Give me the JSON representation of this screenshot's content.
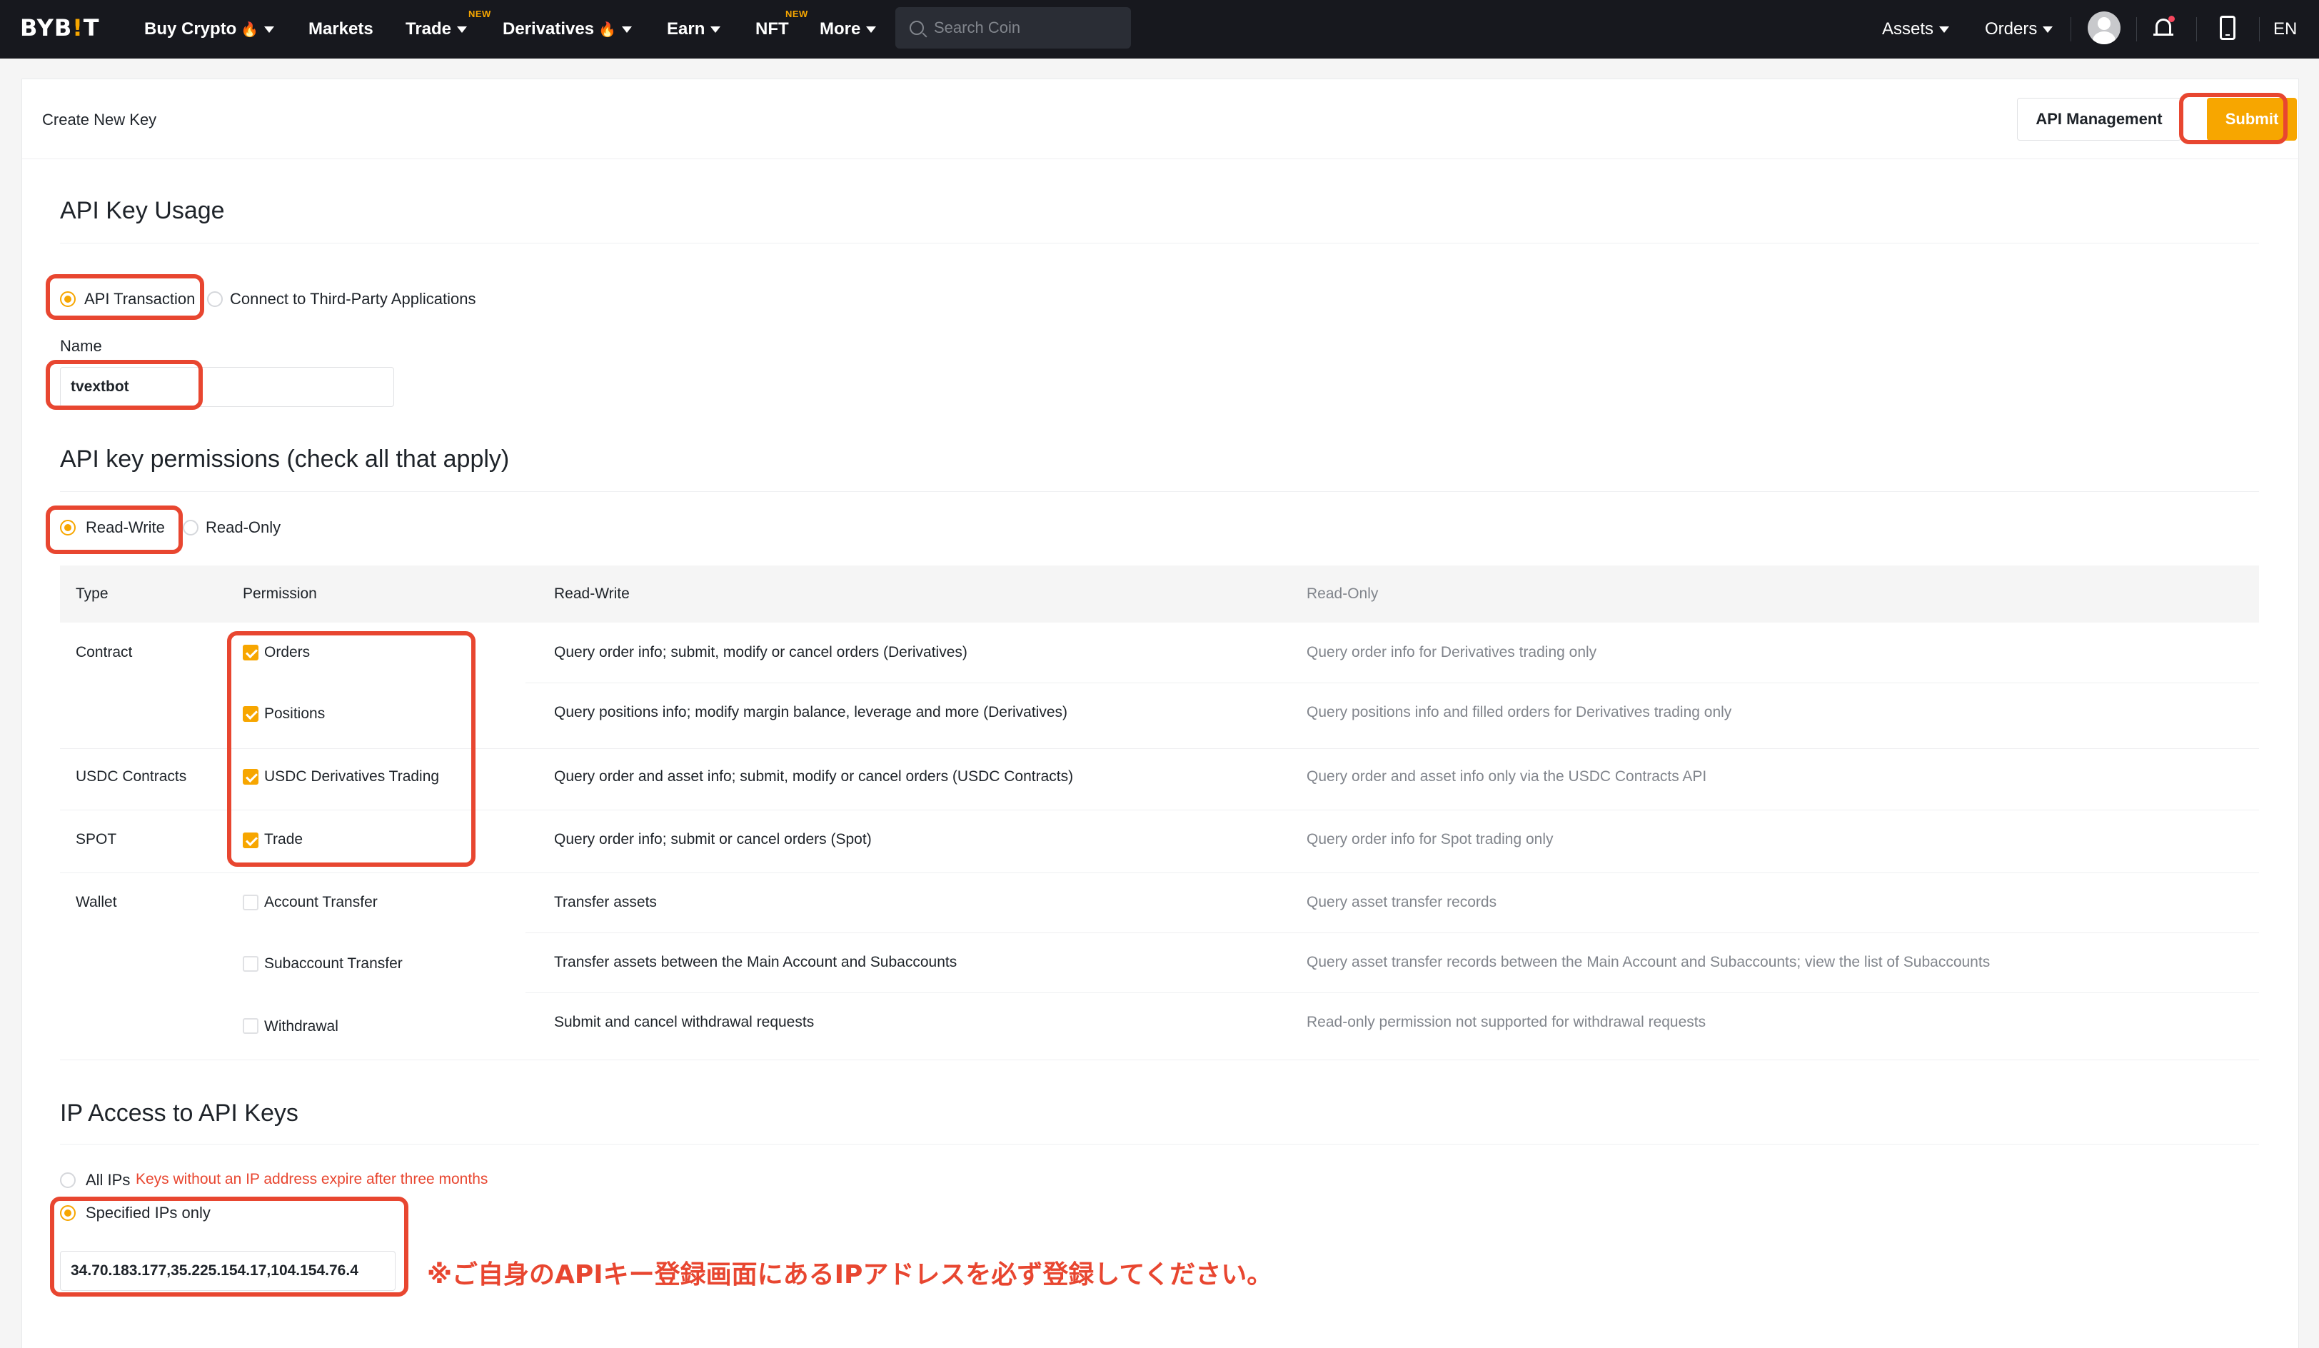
{
  "nav": {
    "logo_text": "BYB",
    "logo_accent": "!",
    "logo_end": "T",
    "items": [
      {
        "label": "Buy Crypto",
        "flame": "🔥",
        "caret": true
      },
      {
        "label": "Markets"
      },
      {
        "label": "Trade",
        "caret": true,
        "badge": "NEW"
      },
      {
        "label": "Derivatives",
        "flame": "🔥",
        "caret": true
      },
      {
        "label": "Earn",
        "caret": true
      },
      {
        "label": "NFT",
        "badge": "NEW"
      },
      {
        "label": "More",
        "caret": true
      }
    ],
    "search_placeholder": "Search Coin",
    "assets": "Assets",
    "orders": "Orders",
    "lang": "EN"
  },
  "header": {
    "title": "Create New Key",
    "api_management": "API Management",
    "submit": "Submit"
  },
  "usage": {
    "title": "API Key Usage",
    "option_api": "API Transaction",
    "option_third": "Connect to Third-Party Applications",
    "name_label": "Name",
    "name_value": "tvextbot"
  },
  "permissions": {
    "title": "API key permissions (check all that apply)",
    "option_rw": "Read-Write",
    "option_ro": "Read-Only",
    "columns": [
      "Type",
      "Permission",
      "Read-Write",
      "Read-Only"
    ],
    "rows": [
      {
        "type": "Contract",
        "perm": "Orders",
        "checked": true,
        "rw": "Query order info; submit, modify or cancel orders (Derivatives)",
        "ro": "Query order info for Derivatives trading only"
      },
      {
        "type": "",
        "perm": "Positions",
        "checked": true,
        "rw": "Query positions info; modify margin balance, leverage and more (Derivatives)",
        "ro": "Query positions info and filled orders for Derivatives trading only"
      },
      {
        "type": "USDC Contracts",
        "perm": "USDC Derivatives Trading",
        "checked": true,
        "rw": "Query order and asset info; submit, modify or cancel orders (USDC Contracts)",
        "ro": "Query order and asset info only via the USDC Contracts API"
      },
      {
        "type": "SPOT",
        "perm": "Trade",
        "checked": true,
        "rw": "Query order info; submit or cancel orders (Spot)",
        "ro": "Query order info for Spot trading only"
      },
      {
        "type": "Wallet",
        "perm": "Account Transfer",
        "checked": false,
        "rw": "Transfer assets",
        "ro": "Query asset transfer records"
      },
      {
        "type": "",
        "perm": "Subaccount Transfer",
        "checked": false,
        "rw": "Transfer assets between the Main Account and Subaccounts",
        "ro": "Query asset transfer records between the Main Account and Subaccounts; view the list of Subaccounts"
      },
      {
        "type": "",
        "perm": "Withdrawal",
        "checked": false,
        "rw": "Submit and cancel withdrawal requests",
        "ro": "Read-only permission not supported for withdrawal requests"
      }
    ]
  },
  "ip": {
    "title": "IP Access to API Keys",
    "option_all": "All IPs",
    "warning": "Keys without an IP address expire after three months",
    "option_specified": "Specified IPs only",
    "ip_value": "34.70.183.177,35.225.154.17,104.154.76.4"
  },
  "annotation": {
    "note": "※ご自身のAPIキー登録画面にあるIPアドレスを必ず登録してください。"
  },
  "colors": {
    "accent": "#f7a600",
    "highlight": "#e84630",
    "nav_bg": "#17181e"
  }
}
